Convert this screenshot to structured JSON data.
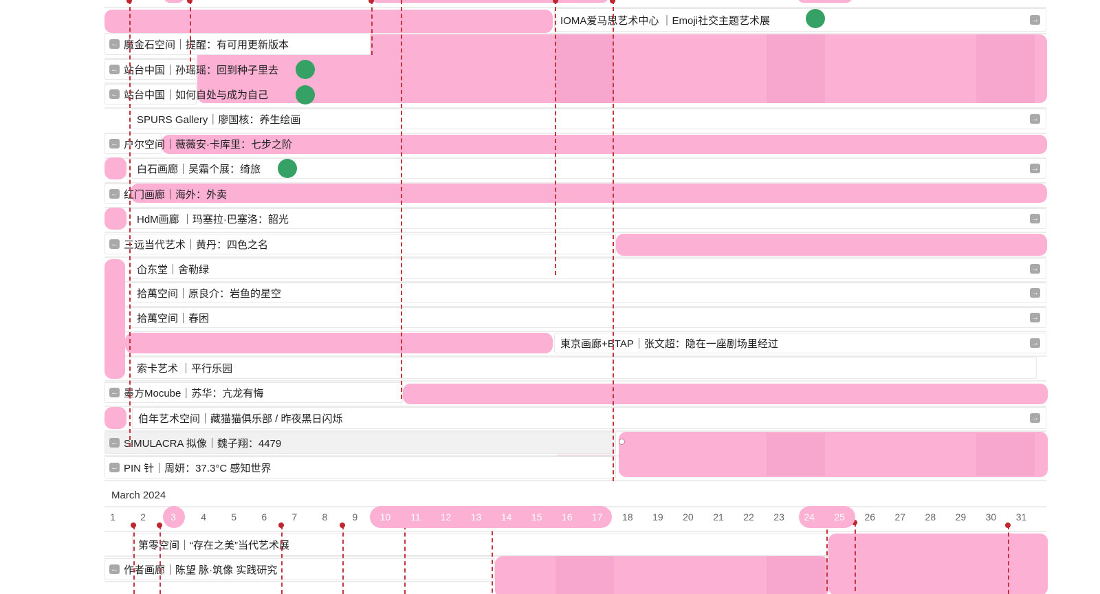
{
  "app": {
    "title": ""
  },
  "calendar": {
    "month": "March 2024"
  },
  "exhibitions": [
    {
      "id": "ioma",
      "label": "IOMA爱马思艺术中心 ｜Emoji社交主题艺术展",
      "status": "green-dot"
    },
    {
      "id": "mojinshi",
      "label": "魔金石空间｜提醒：有可用更新版本"
    },
    {
      "id": "zhantai-1",
      "label": "站台中国｜孙瑶瑶：回到种子里去",
      "status": "green-dot"
    },
    {
      "id": "zhantai-2",
      "label": "站台中国｜如何自处与成为自己",
      "status": "green-dot"
    },
    {
      "id": "spurs",
      "label": "SPURS Gallery｜廖国核：养生绘画"
    },
    {
      "id": "huer",
      "label": "户尔空间｜薇薇安·卡库里：七步之阶"
    },
    {
      "id": "baishi",
      "label": "白石画廊｜吴霜个展：绮旅",
      "status": "green-dot"
    },
    {
      "id": "hongmen",
      "label": "红门画廊｜海外：外卖"
    },
    {
      "id": "hdm",
      "label": "HdM画廊 ｜玛塞拉·巴塞洛：韶光"
    },
    {
      "id": "sanyuan",
      "label": "三远当代艺术｜黄丹：四色之名"
    },
    {
      "id": "zhongdong",
      "label": "仚东堂｜舍勒绿"
    },
    {
      "id": "shiwan-1",
      "label": "拾萬空间｜原良介：岩鱼的星空"
    },
    {
      "id": "shiwan-2",
      "label": "拾萬空间｜春困"
    },
    {
      "id": "dongjing",
      "label": "東京画廊+BTAP｜张文超：隐在一座剧场里经过"
    },
    {
      "id": "suoka",
      "label": "索卡艺术 ｜平行乐园"
    },
    {
      "id": "mofang",
      "label": "墨方Mocube｜苏华：亢龙有悔"
    },
    {
      "id": "bonian",
      "label": "伯年艺术空间｜藏猫猫俱乐部 / 昨夜黑日闪烁"
    },
    {
      "id": "simulacra",
      "label": "SIMULACRA 拟像｜魏子翔：4479"
    },
    {
      "id": "pin",
      "label": "PIN 针｜周妍：37.3°C 感知世界"
    },
    {
      "id": "diling",
      "label": "第零空间｜“存在之美”当代艺术展"
    },
    {
      "id": "zuozhe",
      "label": "作者画廊｜陈望 脉·筑像 实践研究"
    }
  ],
  "days": [
    "1",
    "2",
    "3",
    "4",
    "5",
    "6",
    "7",
    "8",
    "9",
    "10",
    "11",
    "12",
    "13",
    "14",
    "15",
    "16",
    "17",
    "18",
    "19",
    "20",
    "21",
    "22",
    "23",
    "24",
    "25",
    "26",
    "27",
    "28",
    "29",
    "30",
    "31"
  ],
  "highlighted_days": [
    "3",
    "10",
    "11",
    "12",
    "13",
    "14",
    "15",
    "16",
    "17",
    "24",
    "25"
  ],
  "icons": {
    "left_arrow": "arrow-left-square-icon",
    "right_arrow": "arrow-right-square-icon"
  },
  "colors": {
    "bar": "#fbb0d4",
    "status": "#36a165",
    "marker": "#c0262d",
    "highlight": "#fbb0d4"
  }
}
